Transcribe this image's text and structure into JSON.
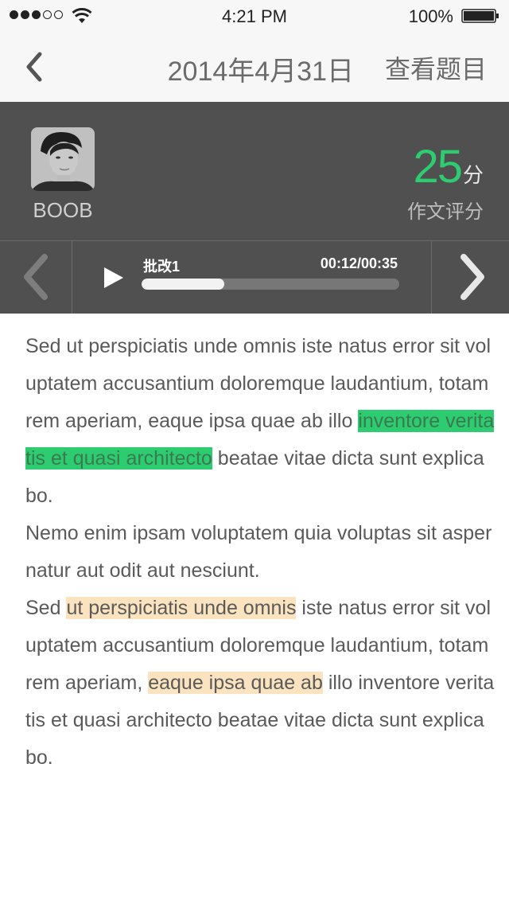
{
  "status_bar": {
    "signal_bars_filled": 3,
    "signal_bars_total": 5,
    "time": "4:21 PM",
    "battery_percent": "100%"
  },
  "nav": {
    "back_icon": "chevron-left-icon",
    "title": "2014年4月31日",
    "action_label": "查看题目"
  },
  "profile": {
    "name": "BOOB",
    "score_value": "25",
    "score_unit": "分",
    "score_label": "作文评分"
  },
  "player": {
    "track_label": "批改1",
    "time_display": "00:12/00:35",
    "progress_fraction": 0.32,
    "prev_icon": "chevron-left-icon",
    "next_icon": "chevron-right-icon",
    "play_icon": "play-icon"
  },
  "essay": {
    "p1_before": "Sed ut perspiciatis unde omnis iste natus error sit voluptatem accusantium doloremque laudantium, totam rem aperiam, eaque ipsa quae ab illo ",
    "p1_highlight": "inventore veritatis et quasi architecto",
    "p1_after": " beatae vitae dicta sunt explicabo.",
    "p2": "Nemo enim ipsam voluptatem quia voluptas sit aspernatur aut odit aut nesciunt.",
    "p3_start": "Sed ",
    "p3_highlight1": "ut perspiciatis unde omnis",
    "p3_mid": " iste natus error sit voluptatem accusantium doloremque laudantium, totam rem aperiam, ",
    "p3_highlight2": "eaque ipsa quae ab",
    "p3_end": " illo inventore veritatis et quasi architecto beatae vitae dicta sunt explicabo."
  },
  "colors": {
    "accent_green": "#2ecc71",
    "panel_dark": "#505050",
    "highlight_orange": "#fae3be"
  }
}
